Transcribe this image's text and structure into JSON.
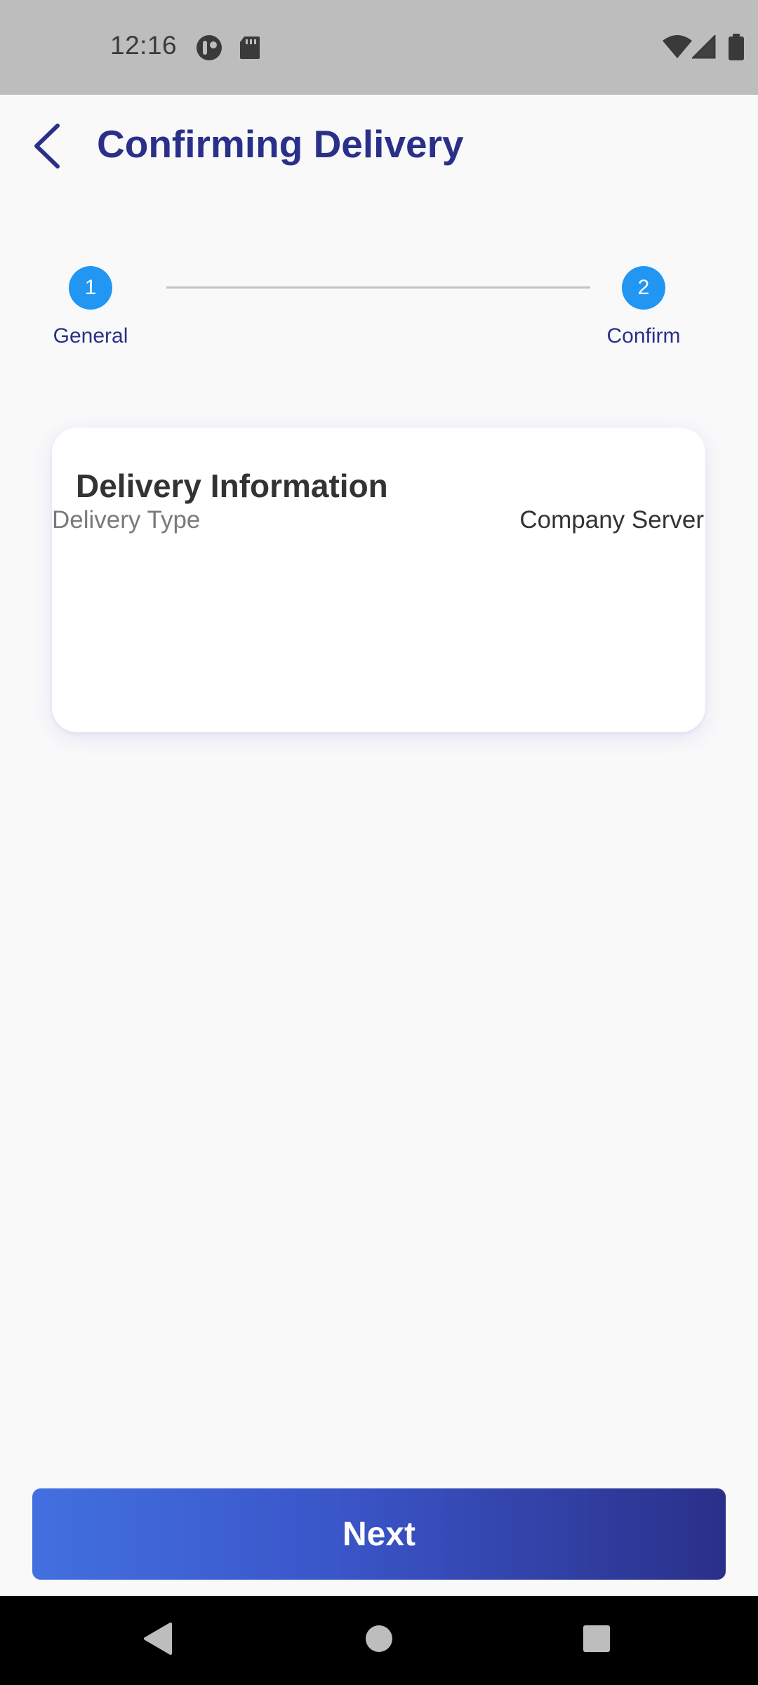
{
  "status_bar": {
    "time": "12:16",
    "icons": [
      "app-indicator-icon",
      "sd-card-icon",
      "wifi-icon",
      "signal-icon",
      "battery-icon"
    ]
  },
  "header": {
    "title": "Confirming Delivery",
    "back_icon": "chevron-left-icon"
  },
  "stepper": {
    "steps": [
      {
        "number": "1",
        "label": "General"
      },
      {
        "number": "2",
        "label": "Confirm"
      }
    ]
  },
  "card": {
    "title": "Delivery Information",
    "rows": [
      {
        "label": "Delivery Type",
        "value": "Company Server"
      }
    ]
  },
  "footer": {
    "next_label": "Next"
  },
  "nav_bar": {
    "icons": [
      "back-triangle-icon",
      "home-circle-icon",
      "recents-square-icon"
    ]
  },
  "colors": {
    "accent": "#2a3089",
    "step_circle": "#2196f3",
    "button_gradient_start": "#4270e0",
    "button_gradient_end": "#2a3089"
  }
}
